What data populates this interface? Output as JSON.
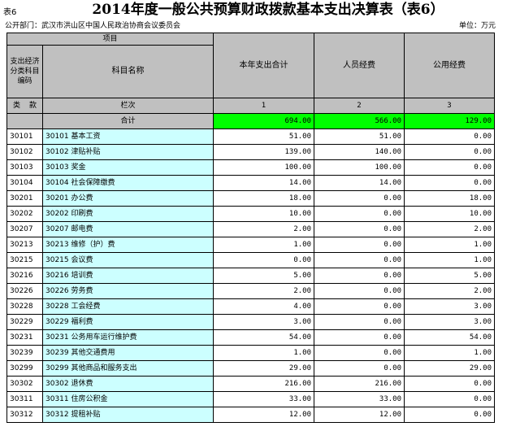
{
  "table_no": "表6",
  "title": "2014年度一般公共预算财政拨款基本支出决算表（表6）",
  "dept": "公开部门：武汉市洪山区中国人民政治协商会议委员会",
  "unit": "单位：万元",
  "header": {
    "project": "项目",
    "code_label": "支出经济分类科目编码",
    "lei": "类",
    "kuan": "款",
    "subject_name": "科目名称",
    "lanci": "栏次",
    "total_label": "合计",
    "col1": "本年支出合计",
    "col2": "人员经费",
    "col3": "公用经费",
    "idx1": "1",
    "idx2": "2",
    "idx3": "3"
  },
  "totals": {
    "total": "694.00",
    "personnel": "566.00",
    "public": "129.00"
  },
  "rows": [
    {
      "code": "30101",
      "name": "30101 基本工资",
      "total": "51.00",
      "personnel": "51.00",
      "public": "0.00"
    },
    {
      "code": "30102",
      "name": "30102 津贴补贴",
      "total": "139.00",
      "personnel": "140.00",
      "public": "0.00"
    },
    {
      "code": "30103",
      "name": "30103 奖金",
      "total": "100.00",
      "personnel": "100.00",
      "public": "0.00"
    },
    {
      "code": "30104",
      "name": "30104 社会保障缴费",
      "total": "14.00",
      "personnel": "14.00",
      "public": "0.00"
    },
    {
      "code": "30201",
      "name": "30201 办公费",
      "total": "18.00",
      "personnel": "0.00",
      "public": "18.00"
    },
    {
      "code": "30202",
      "name": "30202 印刷费",
      "total": "10.00",
      "personnel": "0.00",
      "public": "10.00"
    },
    {
      "code": "30207",
      "name": "30207 邮电费",
      "total": "2.00",
      "personnel": "0.00",
      "public": "2.00"
    },
    {
      "code": "30213",
      "name": "30213 维修（护）费",
      "total": "1.00",
      "personnel": "0.00",
      "public": "1.00"
    },
    {
      "code": "30215",
      "name": "30215 会议费",
      "total": "0.00",
      "personnel": "0.00",
      "public": "1.00"
    },
    {
      "code": "30216",
      "name": "30216 培训费",
      "total": "5.00",
      "personnel": "0.00",
      "public": "5.00"
    },
    {
      "code": "30226",
      "name": "30226 劳务费",
      "total": "2.00",
      "personnel": "0.00",
      "public": "2.00"
    },
    {
      "code": "30228",
      "name": "30228 工会经费",
      "total": "4.00",
      "personnel": "0.00",
      "public": "3.00"
    },
    {
      "code": "30229",
      "name": "30229 福利费",
      "total": "3.00",
      "personnel": "0.00",
      "public": "3.00"
    },
    {
      "code": "30231",
      "name": "30231 公务用车运行维护费",
      "total": "54.00",
      "personnel": "0.00",
      "public": "54.00"
    },
    {
      "code": "30239",
      "name": "30239 其他交通费用",
      "total": "1.00",
      "personnel": "0.00",
      "public": "1.00"
    },
    {
      "code": "30299",
      "name": "30299 其他商品和服务支出",
      "total": "29.00",
      "personnel": "0.00",
      "public": "29.00"
    },
    {
      "code": "30302",
      "name": "30302 退休费",
      "total": "216.00",
      "personnel": "216.00",
      "public": "0.00"
    },
    {
      "code": "30311",
      "name": "30311 住房公积金",
      "total": "33.00",
      "personnel": "33.00",
      "public": "0.00"
    },
    {
      "code": "30312",
      "name": "30312 提租补贴",
      "total": "12.00",
      "personnel": "12.00",
      "public": "0.00"
    }
  ]
}
